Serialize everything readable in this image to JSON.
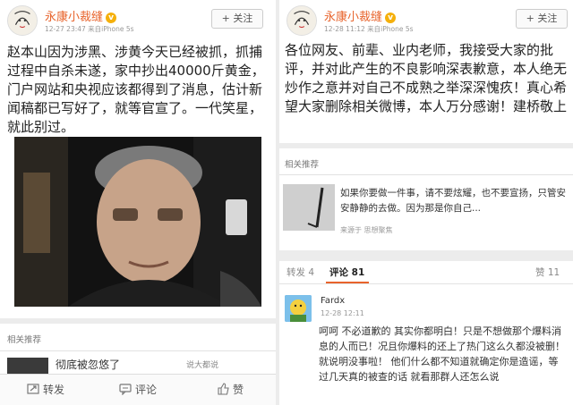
{
  "left": {
    "user": {
      "name": "永康小裁缝",
      "badge": "v",
      "meta": "12-27 23:47  来自iPhone 5s"
    },
    "follow_label": "+ 关注",
    "post_text": "赵本山因为涉黑、涉黄今天已经被抓，抓捕过程中自杀未遂，家中抄出40000斤黄金，门户网站和央视应该都得到了消息，估计新闻稿都已写好了，就等官宣了。一代笑星，就此别过。",
    "related_title": "相关推荐",
    "related_snippet_a": "彻底被忽悠了",
    "related_snippet_b": "说大都说",
    "actions": [
      {
        "label": "转发",
        "icon": "repost-icon"
      },
      {
        "label": "评论",
        "icon": "comment-icon"
      },
      {
        "label": "赞",
        "icon": "like-icon"
      }
    ]
  },
  "right": {
    "user": {
      "name": "永康小裁缝",
      "badge": "v",
      "meta": "12-28 11:12  来自iPhone 5s"
    },
    "follow_label": "+ 关注",
    "post_text": "各位网友、前辈、业内老师，我接受大家的批评，并对此产生的不良影响深表歉意，本人绝无炒作之意并对自己不成熟之举深深愧疚！真心希望大家删除相关微博，本人万分感谢！建桥敬上",
    "related_title": "相关推荐",
    "related_text": "如果你要做一件事，请不要炫耀，也不要宣扬，只管安安静静的去做。因为那是你自己...",
    "related_source": "来源于 思想聚焦",
    "tabs": {
      "repost": "转发 4",
      "comment": "评论 81",
      "like": "赞 11"
    },
    "comment": {
      "name": "Fardx",
      "time": "12-28 12:11",
      "text": "呵呵 不必道歉的 其实你都明白！只是不想做那个爆料消息的人而已！况且你爆料的还上了热门这么久都没被删！就说明没事啦！ 他们什么都不知道就确定你是造谣，等过几天真的被查的话 就看那群人还怎么说"
    }
  },
  "colors": {
    "accent": "#e8642c",
    "badge": "#f5b00b"
  }
}
